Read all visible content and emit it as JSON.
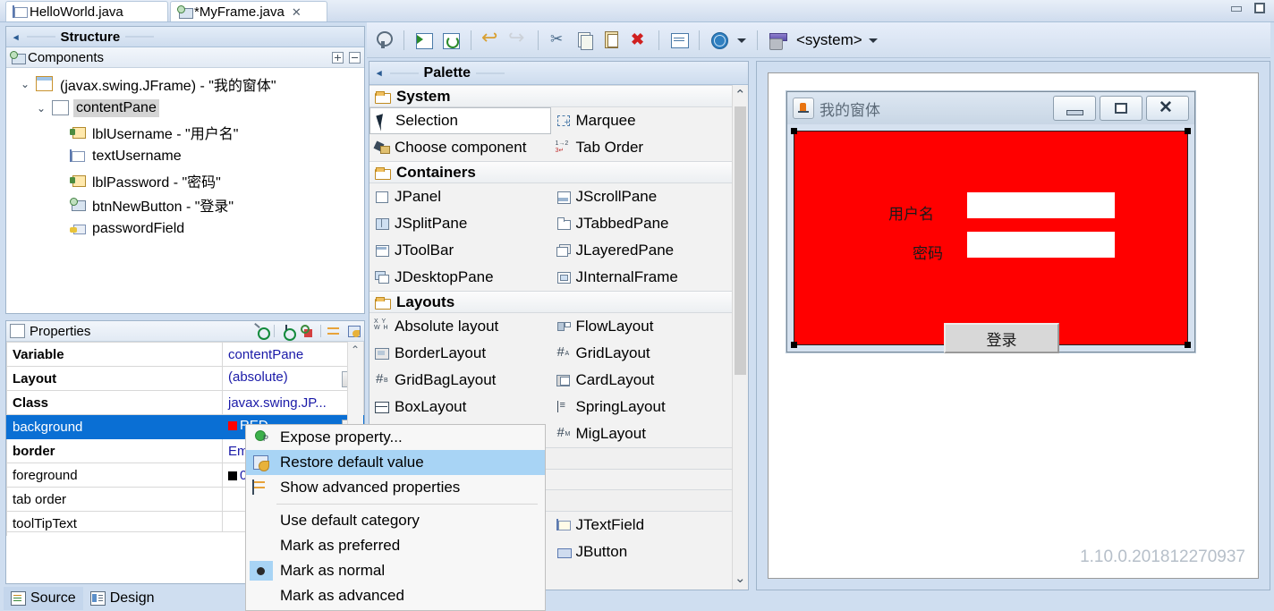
{
  "window": {
    "minimize_glyph": "—",
    "maximize_glyph": "□"
  },
  "editor_tabs": [
    {
      "label": "HelloWorld.java",
      "icon": "java-file-icon",
      "active": false,
      "close": ""
    },
    {
      "label": "*MyFrame.java",
      "icon": "java-class-icon",
      "active": true,
      "close": "✕"
    }
  ],
  "structure_view": {
    "title": "Structure",
    "collapse_arrow": "◂",
    "components": {
      "title": "Components",
      "expand_all": "+",
      "collapse_all": "−",
      "tree": [
        {
          "label": "(javax.swing.JFrame) - \"我的窗体\"",
          "indent": 0,
          "twisty": "⌄",
          "icon": "jframe-icon",
          "selected": false
        },
        {
          "label": "contentPane",
          "indent": 1,
          "twisty": "⌄",
          "icon": "jpanel-icon",
          "selected": true
        },
        {
          "label": "lblUsername - \"用户名\"",
          "indent": 2,
          "twisty": "",
          "icon": "jlabel-icon",
          "selected": false
        },
        {
          "label": "textUsername",
          "indent": 2,
          "twisty": "",
          "icon": "jtextfield-icon",
          "selected": false
        },
        {
          "label": "lblPassword - \"密码\"",
          "indent": 2,
          "twisty": "",
          "icon": "jlabel-icon",
          "selected": false
        },
        {
          "label": "btnNewButton - \"登录\"",
          "indent": 2,
          "twisty": "",
          "icon": "jbutton-icon",
          "selected": false
        },
        {
          "label": "passwordField",
          "indent": 2,
          "twisty": "",
          "icon": "jpasswordfield-icon",
          "selected": false
        }
      ]
    }
  },
  "properties_view": {
    "title": "Properties",
    "rows": [
      {
        "name": "Variable",
        "value": "contentPane",
        "bold": true,
        "selected": false,
        "swatch": "",
        "combo": false
      },
      {
        "name": "Layout",
        "value": "(absolute)",
        "bold": true,
        "selected": false,
        "swatch": "",
        "combo": true
      },
      {
        "name": "Class",
        "value": "javax.swing.JP...",
        "bold": true,
        "selected": false,
        "swatch": "",
        "combo": false
      },
      {
        "name": "background",
        "value": "RED",
        "bold": false,
        "selected": true,
        "swatch": "#ff0000",
        "combo": true
      },
      {
        "name": "border",
        "value": "Em",
        "bold": true,
        "selected": false,
        "swatch": "",
        "combo": false
      },
      {
        "name": "foreground",
        "value": "0,",
        "bold": false,
        "selected": false,
        "swatch": "#000000",
        "combo": false
      },
      {
        "name": "tab order",
        "value": "",
        "bold": false,
        "selected": false,
        "swatch": "",
        "combo": false
      },
      {
        "name": "toolTipText",
        "value": "",
        "bold": false,
        "selected": false,
        "swatch": "",
        "combo": false
      }
    ],
    "scroll_up": "⌃"
  },
  "context_menu": {
    "items": [
      {
        "label": "Expose property...",
        "icon": "expose-property-icon",
        "highlighted": false,
        "radio": false
      },
      {
        "label": "Restore default value",
        "icon": "restore-default-icon",
        "highlighted": true,
        "radio": false
      },
      {
        "label": "Show advanced properties",
        "icon": "advanced-properties-icon",
        "highlighted": false,
        "radio": false
      },
      {
        "separator": true
      },
      {
        "label": "Use default category",
        "icon": "",
        "highlighted": false,
        "radio": false
      },
      {
        "label": "Mark as preferred",
        "icon": "",
        "highlighted": false,
        "radio": false
      },
      {
        "label": "Mark as normal",
        "icon": "",
        "highlighted": false,
        "radio": true
      },
      {
        "label": "Mark as advanced",
        "icon": "",
        "highlighted": false,
        "radio": false
      }
    ]
  },
  "editor_toolbar": {
    "buttons": [
      {
        "name": "test-button",
        "icon": "test-icon",
        "disabled": false
      },
      {
        "name": "refresh-button",
        "icon": "refresh-icon",
        "disabled": false
      },
      {
        "name": "refresh-alt-button",
        "icon": "refresh-alt-icon",
        "disabled": false
      },
      {
        "name": "undo-button",
        "icon": "undo-icon",
        "disabled": false
      },
      {
        "name": "redo-button",
        "icon": "redo-icon",
        "disabled": true
      },
      {
        "name": "cut-button",
        "icon": "cut-icon",
        "disabled": false
      },
      {
        "name": "copy-button",
        "icon": "copy-icon",
        "disabled": false
      },
      {
        "name": "paste-button",
        "icon": "paste-icon",
        "disabled": false
      },
      {
        "name": "delete-button",
        "icon": "delete-icon",
        "disabled": false
      },
      {
        "name": "align-button",
        "icon": "align-icon",
        "disabled": false
      },
      {
        "name": "locale-button",
        "icon": "globe-icon",
        "disabled": false
      }
    ],
    "lookandfeel_label": "<system>"
  },
  "palette": {
    "title": "Palette",
    "collapse_arrow": "◂",
    "categories": [
      {
        "name": "System",
        "items": [
          {
            "label": "Selection",
            "icon": "cursor-icon",
            "selected": true
          },
          {
            "label": "Marquee",
            "icon": "marquee-icon",
            "selected": false
          },
          {
            "label": "Choose component",
            "icon": "choose-component-icon",
            "selected": false
          },
          {
            "label": "Tab Order",
            "icon": "tab-order-icon",
            "selected": false
          }
        ]
      },
      {
        "name": "Containers",
        "items": [
          {
            "label": "JPanel",
            "icon": "jpanel-icon",
            "selected": false
          },
          {
            "label": "JScrollPane",
            "icon": "jscrollpane-icon",
            "selected": false
          },
          {
            "label": "JSplitPane",
            "icon": "jsplitpane-icon",
            "selected": false
          },
          {
            "label": "JTabbedPane",
            "icon": "jtabbedpane-icon",
            "selected": false
          },
          {
            "label": "JToolBar",
            "icon": "jtoolbar-icon",
            "selected": false
          },
          {
            "label": "JLayeredPane",
            "icon": "jlayeredpane-icon",
            "selected": false
          },
          {
            "label": "JDesktopPane",
            "icon": "jdesktoppane-icon",
            "selected": false
          },
          {
            "label": "JInternalFrame",
            "icon": "jinternalframe-icon",
            "selected": false
          }
        ]
      },
      {
        "name": "Layouts",
        "items": [
          {
            "label": "Absolute layout",
            "icon": "absolute-layout-icon",
            "selected": false
          },
          {
            "label": "FlowLayout",
            "icon": "flowlayout-icon",
            "selected": false
          },
          {
            "label": "BorderLayout",
            "icon": "borderlayout-icon",
            "selected": false
          },
          {
            "label": "GridLayout",
            "icon": "gridlayout-icon",
            "selected": false
          },
          {
            "label": "GridBagLayout",
            "icon": "gridbaglayout-icon",
            "selected": false
          },
          {
            "label": "CardLayout",
            "icon": "cardlayout-icon",
            "selected": false
          },
          {
            "label": "BoxLayout",
            "icon": "boxlayout-icon",
            "selected": false
          },
          {
            "label": "SpringLayout",
            "icon": "springlayout-icon",
            "selected": false
          },
          {
            "label": "MigLayout",
            "icon": "miglayout-icon",
            "selected": false
          }
        ]
      }
    ],
    "bottom_items": [
      {
        "label": "JTextField",
        "icon": "jtextfield-icon"
      },
      {
        "label": "JButton",
        "icon": "jbutton-icon"
      }
    ],
    "scroll_up": "⌃",
    "scroll_down": "⌄"
  },
  "design_canvas": {
    "frame": {
      "title": "我的窗体",
      "icon": "java-coffee-icon",
      "minimize": "minimize-icon",
      "maximize": "maximize-icon",
      "close": "close-icon",
      "background_color": "#ff0000",
      "children": [
        {
          "type": "label",
          "name": "lblUsername",
          "text": "用户名"
        },
        {
          "type": "label",
          "name": "lblPassword",
          "text": "密码"
        },
        {
          "type": "textfield",
          "name": "textUsername",
          "text": ""
        },
        {
          "type": "passwordfield",
          "name": "passwordField",
          "text": ""
        },
        {
          "type": "button",
          "name": "btnNewButton",
          "text": "登录"
        }
      ]
    },
    "version": "1.10.0.201812270937"
  },
  "bottom_tabs": [
    {
      "label": "Source",
      "icon": "source-icon",
      "active": false
    },
    {
      "label": "Design",
      "icon": "design-icon",
      "active": true
    }
  ]
}
